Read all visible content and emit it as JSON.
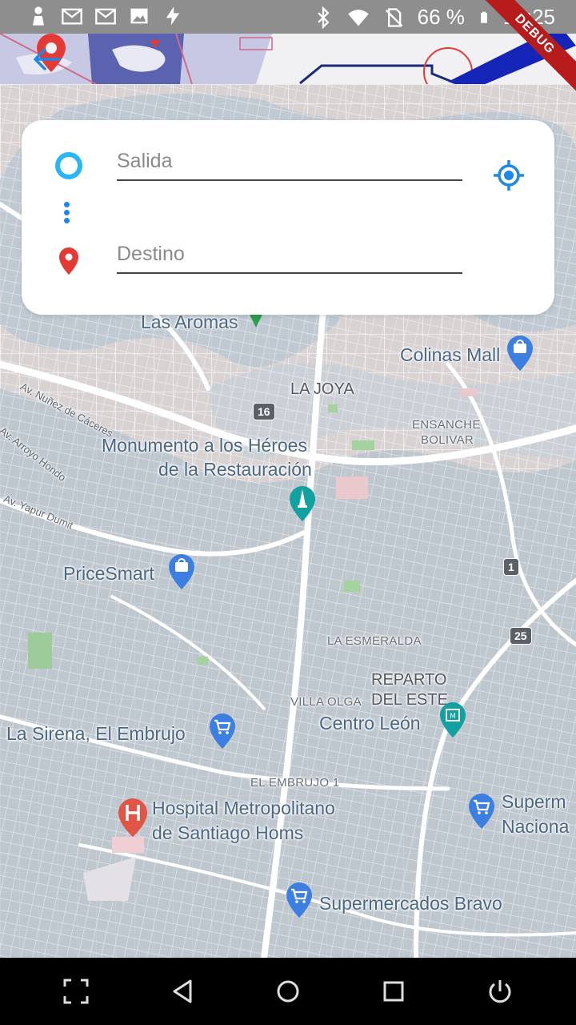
{
  "status_bar": {
    "battery": "66 %",
    "time": "19:25",
    "icons": [
      "person-icon",
      "gmail-icon",
      "gmail-icon",
      "image-icon",
      "flash-icon",
      "bluetooth-icon",
      "wifi-icon",
      "no-sim-icon",
      "battery-icon"
    ]
  },
  "debug_banner": "DEBUG",
  "search": {
    "origin_placeholder": "Salida",
    "destination_placeholder": "Destino",
    "origin_value": "",
    "destination_value": ""
  },
  "map": {
    "labels": {
      "las_aromas": "Las Aromas",
      "colinas_mall": "Colinas Mall",
      "la_joya": "LA JOYA",
      "ensanche_bolivar_1": "ENSANCHE",
      "ensanche_bolivar_2": "BOLIVAR",
      "monumento_1": "Monumento a los Héroes",
      "monumento_2": "de la Restauración",
      "av_nunez": "Av. Nuñez de Cáceres",
      "av_arroyo": "Av. Arroyo Hondo",
      "av_yapur": "Av. Yapur Dumit",
      "pricesmart": "PriceSmart",
      "la_esmeralda": "LA ESMERALDA",
      "reparto_1": "REPARTO",
      "reparto_2": "DEL ESTE",
      "villa_olga": "VILLA OLGA",
      "centro_leon": "Centro León",
      "la_sirena": "La Sirena, El Embrujo",
      "el_embrujo": "EL EMBRUJO 1",
      "hospital_1": "Hospital Metropolitano",
      "hospital_2": "de Santiago Homs",
      "superm_1": "Superm",
      "superm_2": "Naciona",
      "bravo": "Supermercados Bravo"
    },
    "shields": {
      "r16": "16",
      "r1": "1",
      "r25": "25"
    }
  },
  "colors": {
    "accent_blue": "#1e88e5",
    "origin_ring": "#29b6f6",
    "destination_red": "#e53935",
    "map_road": "#ffffff",
    "map_block": "#b9c8d3"
  }
}
